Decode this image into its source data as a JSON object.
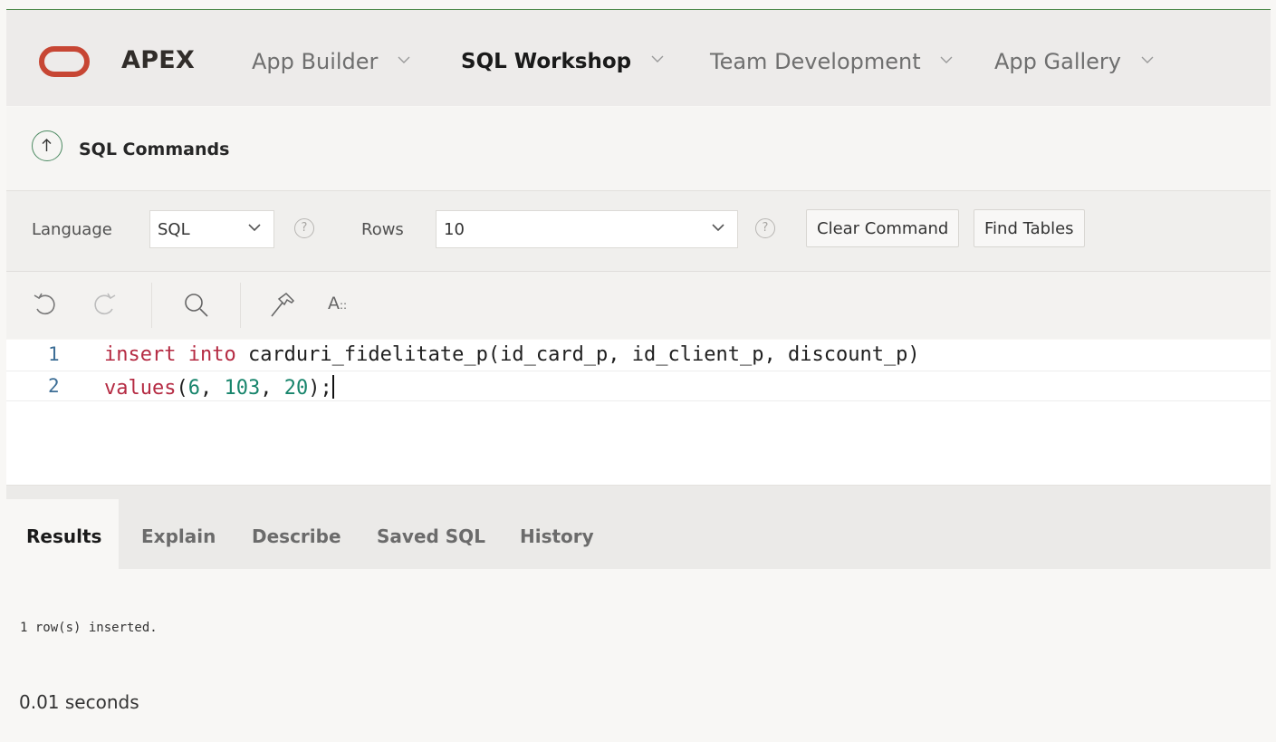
{
  "header": {
    "brand": "APEX",
    "nav": [
      {
        "label": "App Builder",
        "active": false
      },
      {
        "label": "SQL Workshop",
        "active": true
      },
      {
        "label": "Team Development",
        "active": false
      },
      {
        "label": "App Gallery",
        "active": false
      }
    ]
  },
  "page": {
    "title": "SQL Commands"
  },
  "settings": {
    "language_label": "Language",
    "language_value": "SQL",
    "rows_label": "Rows",
    "rows_value": "10",
    "help_glyph": "?",
    "clear_command": "Clear Command",
    "find_tables": "Find Tables"
  },
  "toolbar": {
    "icons": [
      "undo-icon",
      "redo-icon",
      "search-icon",
      "hammer-icon",
      "font-size-icon"
    ],
    "font_label": "A",
    "font_suffix": "::"
  },
  "editor": {
    "lines": [
      {
        "number": "1",
        "kw": "insert into",
        "text": " carduri_fidelitate_p(id_card_p, id_client_p, discount_p)"
      },
      {
        "number": "2",
        "kw": "values",
        "open": "(",
        "n1": "6",
        "sep1": ", ",
        "n2": "103",
        "sep2": ", ",
        "n3": "20",
        "close": ");"
      }
    ]
  },
  "tabs": [
    {
      "label": "Results",
      "active": true
    },
    {
      "label": "Explain",
      "active": false
    },
    {
      "label": "Describe",
      "active": false
    },
    {
      "label": "Saved SQL",
      "active": false
    },
    {
      "label": "History",
      "active": false
    }
  ],
  "results": {
    "message": "1 row(s) inserted.",
    "elapsed": "0.01 seconds"
  },
  "colors": {
    "brand_red": "#c74634",
    "accent_green": "#4c8a62",
    "keyword": "#b52b43",
    "number": "#18856c"
  }
}
